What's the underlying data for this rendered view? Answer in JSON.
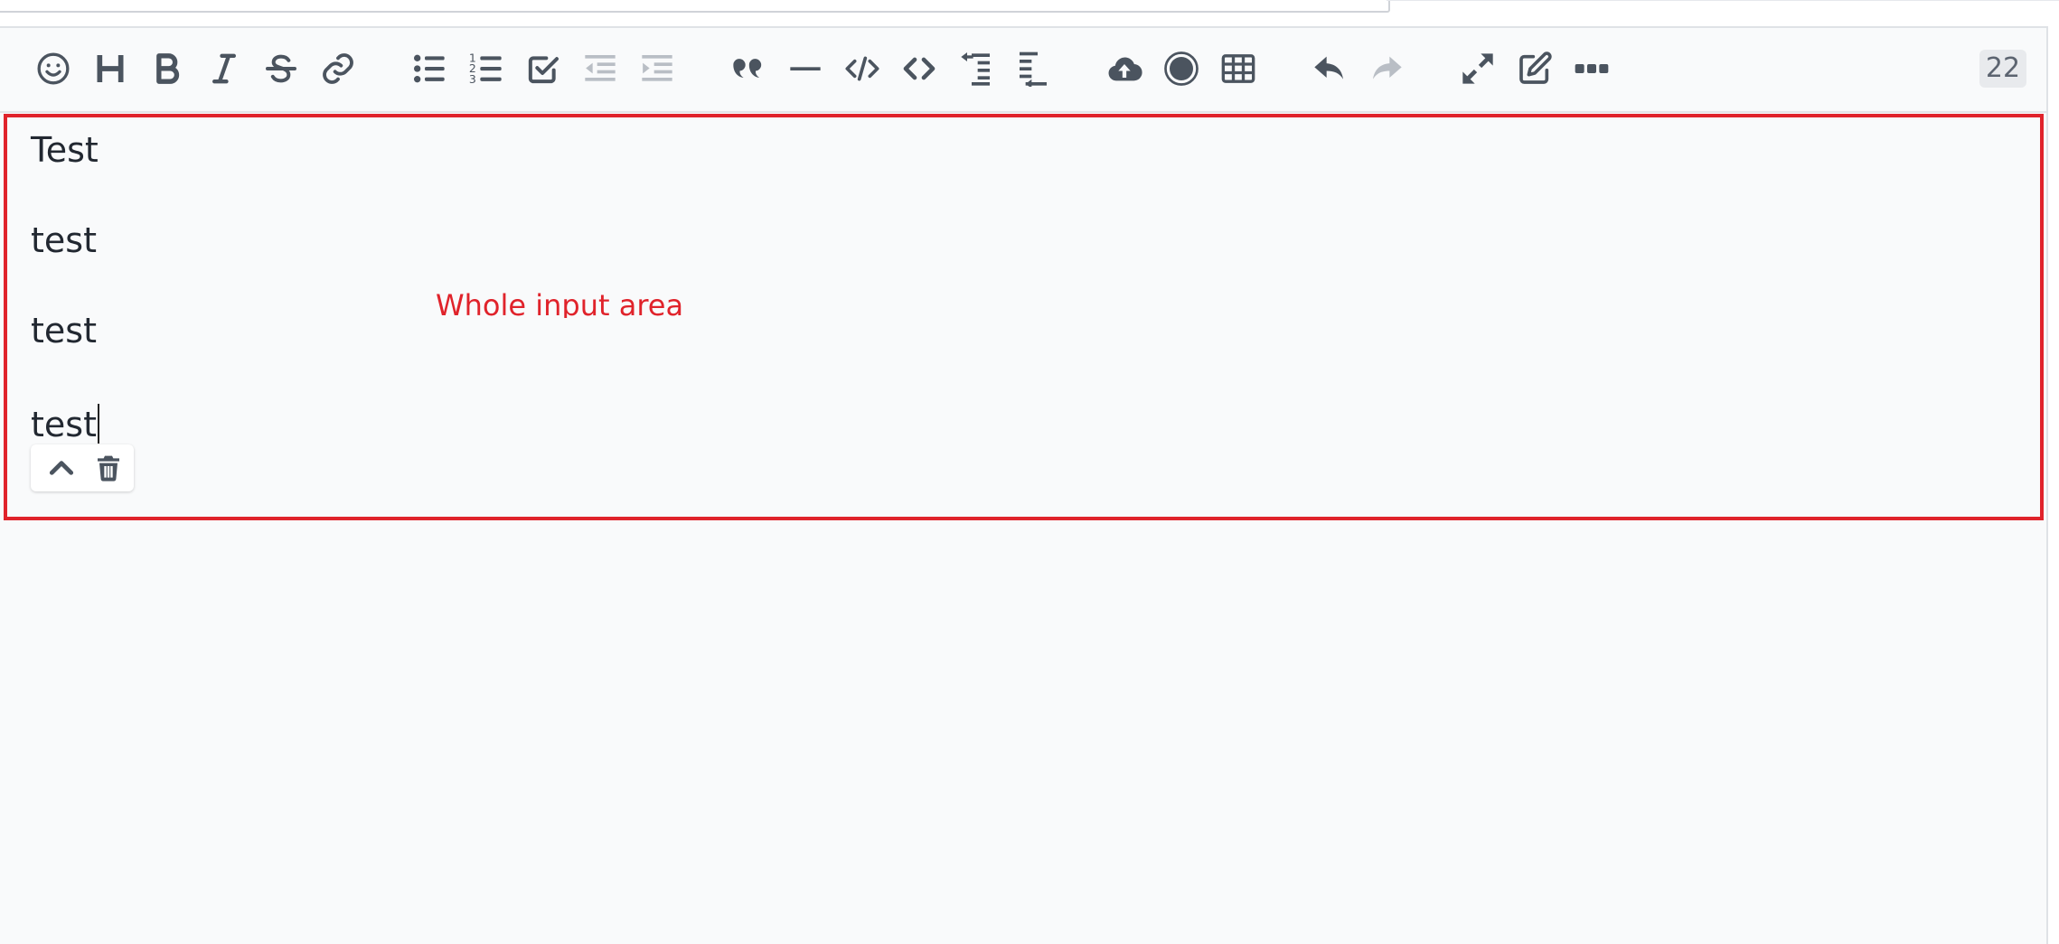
{
  "toolbar": {
    "buttons": [
      {
        "name": "emoji",
        "icon": "smiley-icon",
        "enabled": true
      },
      {
        "name": "heading",
        "icon": "heading-icon",
        "enabled": true
      },
      {
        "name": "bold",
        "icon": "bold-icon",
        "enabled": true
      },
      {
        "name": "italic",
        "icon": "italic-icon",
        "enabled": true
      },
      {
        "name": "strikethrough",
        "icon": "strikethrough-icon",
        "enabled": true
      },
      {
        "name": "link",
        "icon": "link-icon",
        "enabled": true
      },
      {
        "name": "bullet-list",
        "icon": "bullet-list-icon",
        "enabled": true
      },
      {
        "name": "ordered-list",
        "icon": "ordered-list-icon",
        "enabled": true
      },
      {
        "name": "task-list",
        "icon": "checkbox-icon",
        "enabled": true
      },
      {
        "name": "outdent",
        "icon": "outdent-icon",
        "enabled": false
      },
      {
        "name": "indent",
        "icon": "indent-icon",
        "enabled": false
      },
      {
        "name": "quote",
        "icon": "quote-icon",
        "enabled": true
      },
      {
        "name": "horizontal-rule",
        "icon": "horizontal-rule-icon",
        "enabled": true
      },
      {
        "name": "code-block",
        "icon": "code-block-icon",
        "enabled": true
      },
      {
        "name": "inline-code",
        "icon": "inline-code-icon",
        "enabled": true
      },
      {
        "name": "insert-before",
        "icon": "insert-before-icon",
        "enabled": true
      },
      {
        "name": "insert-after",
        "icon": "insert-after-icon",
        "enabled": true
      },
      {
        "name": "upload",
        "icon": "cloud-upload-icon",
        "enabled": true
      },
      {
        "name": "record",
        "icon": "record-icon",
        "enabled": true
      },
      {
        "name": "table",
        "icon": "table-icon",
        "enabled": true
      },
      {
        "name": "undo",
        "icon": "undo-icon",
        "enabled": true
      },
      {
        "name": "redo",
        "icon": "redo-icon",
        "enabled": false
      },
      {
        "name": "fullscreen",
        "icon": "expand-icon",
        "enabled": true
      },
      {
        "name": "edit-mode",
        "icon": "edit-icon",
        "enabled": true
      },
      {
        "name": "more",
        "icon": "more-icon",
        "enabled": true
      }
    ],
    "counter": "22"
  },
  "editor": {
    "paragraphs": [
      "Test",
      "test",
      "test",
      "test"
    ]
  },
  "annotation": {
    "label": "Whole input area",
    "color": "#e0232b"
  },
  "block_toolbar": {
    "buttons": [
      {
        "name": "move-up",
        "icon": "chevron-up-icon"
      },
      {
        "name": "delete",
        "icon": "trash-icon"
      }
    ]
  }
}
